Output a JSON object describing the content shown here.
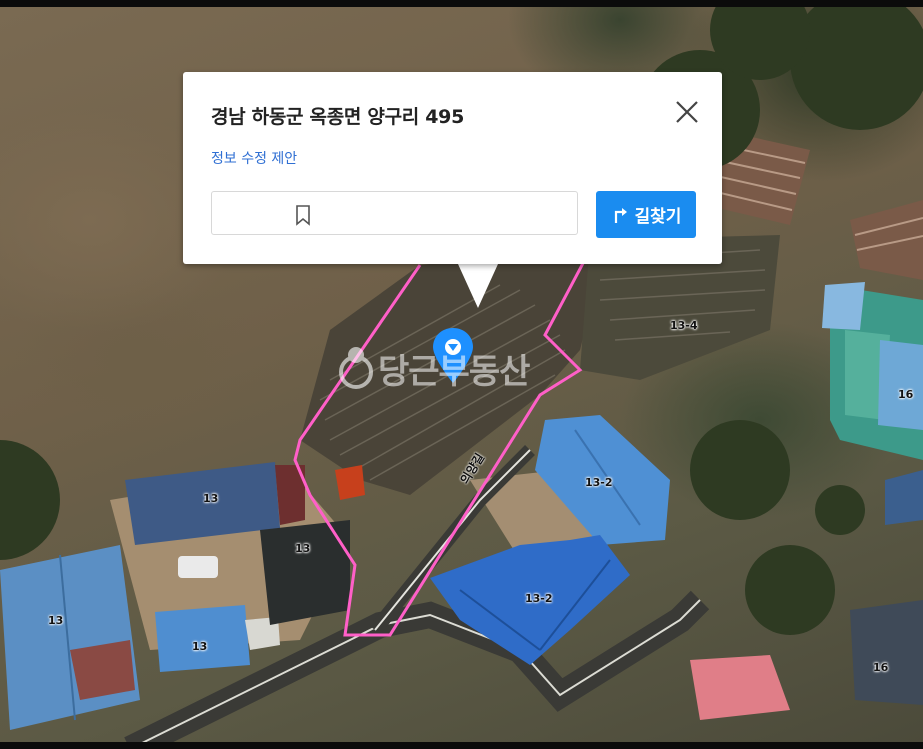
{
  "popup": {
    "address": "경남 하동군 옥종면 양구리 495",
    "edit_link": "정보 수정 제안",
    "route_label": "길찾기"
  },
  "map": {
    "road_name": "의양길",
    "watermark": "당근부동산",
    "parcel_labels": [
      "13-4",
      "16",
      "13-2",
      "13",
      "13",
      "13",
      "13",
      "13-2",
      "16"
    ]
  },
  "colors": {
    "route_button": "#1a8cf0",
    "parcel_outline": "#ff5fc8",
    "link": "#2f6fd3",
    "pin": "#1e90ff"
  },
  "icons": [
    "close-icon",
    "bookmark-icon",
    "share-icon",
    "route-icon",
    "location-pin-icon"
  ]
}
